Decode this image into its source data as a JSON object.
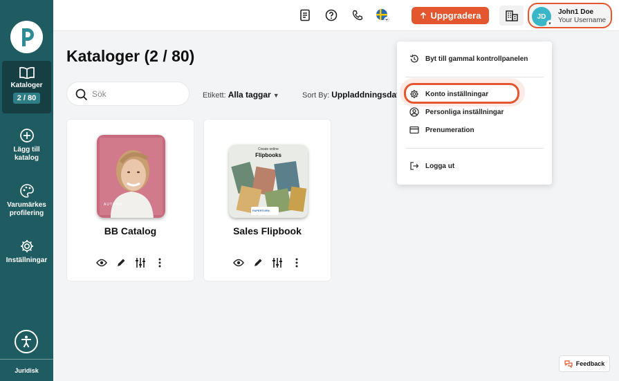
{
  "sidebar": {
    "items": [
      {
        "label": "Kataloger",
        "badge": "2 / 80"
      },
      {
        "label": "Lägg till katalog"
      },
      {
        "label": "Varumärkes profilering"
      },
      {
        "label": "Inställningar"
      }
    ],
    "footer_link": "Juridisk"
  },
  "topbar": {
    "upgrade_label": "Uppgradera",
    "user_initials": "JD",
    "user_name": "John1 Doe",
    "user_subtitle": "Your Username"
  },
  "main": {
    "title": "Kataloger (2 / 80)",
    "search_placeholder": "Sök",
    "tag_filter_label": "Etikett:",
    "tag_filter_value": "Alla taggar",
    "sort_label": "Sort By:",
    "sort_value": "Uppladdningsdat",
    "catalogs": [
      {
        "title": "BB Catalog",
        "thumb_text": "AUTUMN"
      },
      {
        "title": "Sales Flipbook",
        "thumb_text_top": "Create online",
        "thumb_text_main": "Flipbooks",
        "thumb_brand": "PAPERTURN"
      }
    ]
  },
  "dropdown": {
    "items": [
      {
        "label": "Byt till gammal kontrollpanelen"
      },
      {
        "label": "Konto inställningar"
      },
      {
        "label": "Personliga inställningar"
      },
      {
        "label": "Prenumeration"
      },
      {
        "label": "Logga ut"
      }
    ]
  },
  "feedback_label": "Feedback",
  "colors": {
    "sidebar": "#1f5c61",
    "sidebar_active": "#163f44",
    "accent": "#e4572e",
    "avatar": "#3bb6c9"
  }
}
